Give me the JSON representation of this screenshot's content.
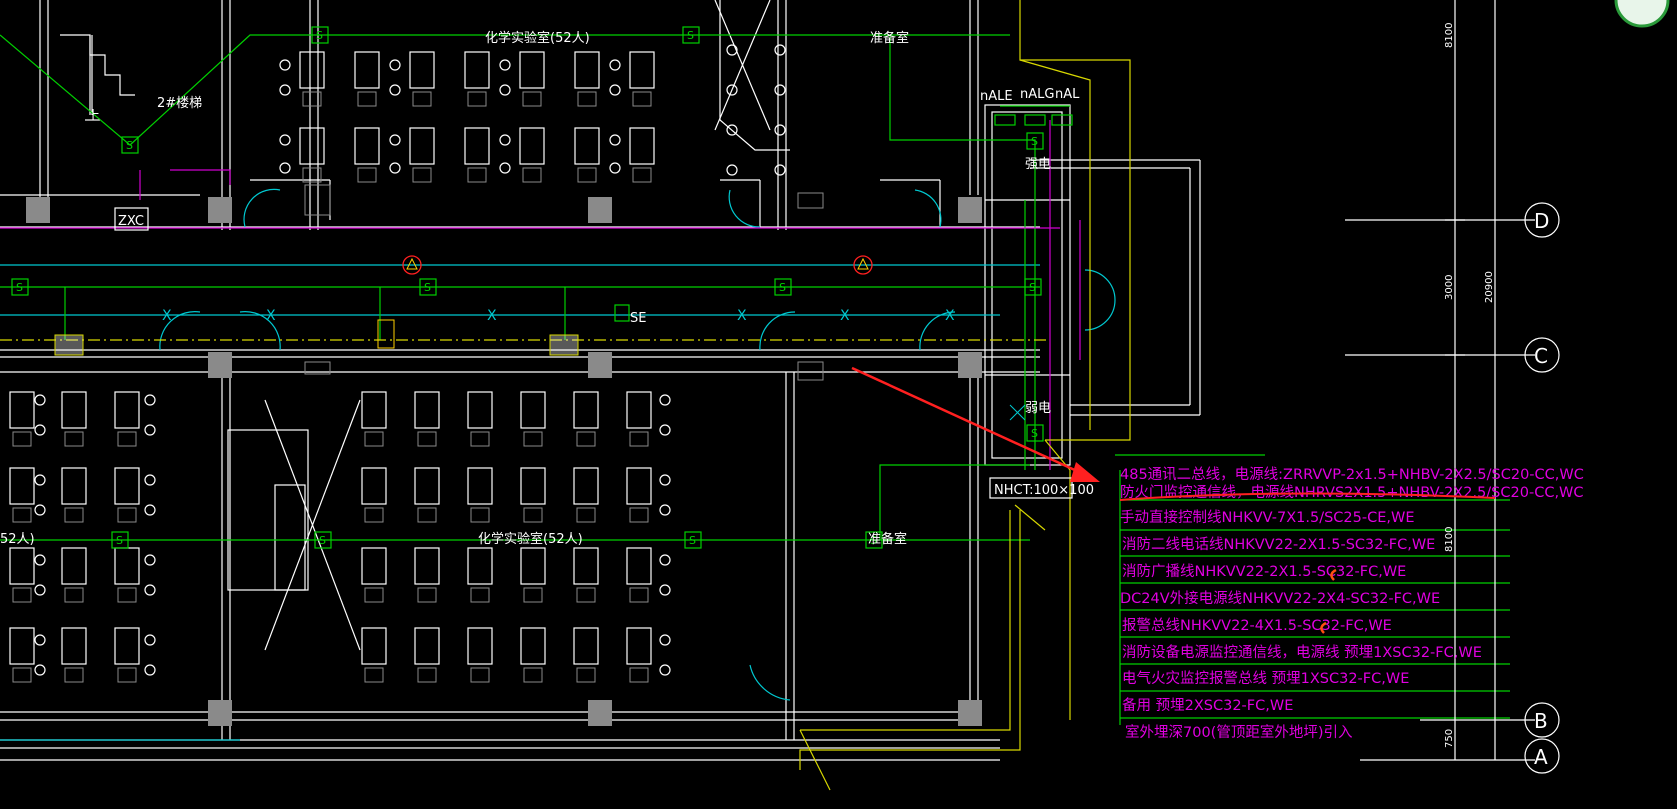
{
  "rooms": {
    "lab_top": "化学实验室(52人)",
    "lab_bottom": "化学实验室(52人)",
    "lab_left_partial": "52人)",
    "prep_top": "准备室",
    "prep_bottom": "准备室",
    "stair": "2#楼梯",
    "stair_up": "上",
    "strong_elec": "强电",
    "weak_elec": "弱电"
  },
  "panel_labels": {
    "zxc": "ZXC",
    "nale": "nALE",
    "nalg": "nALG",
    "nal": "nAL",
    "se": "SE"
  },
  "trunking_label": "NHCT:100×100",
  "axes": [
    "D",
    "C",
    "B",
    "A"
  ],
  "dimensions": [
    "8100",
    "3000",
    "20900",
    "8100",
    "750"
  ],
  "cable_list": [
    "485通讯二总线，电源线:ZRRVVP-2x1.5+NHBV-2X2.5/SC20-CC,WC",
    "防火门监控通信线，电源线NHRVS2X1.5+NHBV-2X2.5/SC20-CC,WC",
    "手动直接控制线NHKVV-7X1.5/SC25-CE,WE",
    "消防二线电话线NHKVV22-2X1.5-SC32-FC,WE",
    "消防广播线NHKVV22-2X1.5-SC32-FC,WE",
    "DC24V外接电源线NHKVV22-2X4-SC32-FC,WE",
    "报警总线NHKVV22-4X1.5-SC32-FC,WE",
    "消防设备电源监控通信线，电源线 预埋1XSC32-FC,WE",
    "电气火灾监控报警总线 预埋1XSC32-FC,WE",
    "备用 预埋2XSC32-FC,WE",
    "室外埋深700(管顶距室外地坪)引入"
  ],
  "colors": {
    "background": "#000000",
    "wall": "#ffffff",
    "cable": "#00d000",
    "door": "#00c8d0",
    "fire_line": "#d000d0",
    "outline": "#d8d800",
    "annotation_arrow": "#ff2020"
  }
}
